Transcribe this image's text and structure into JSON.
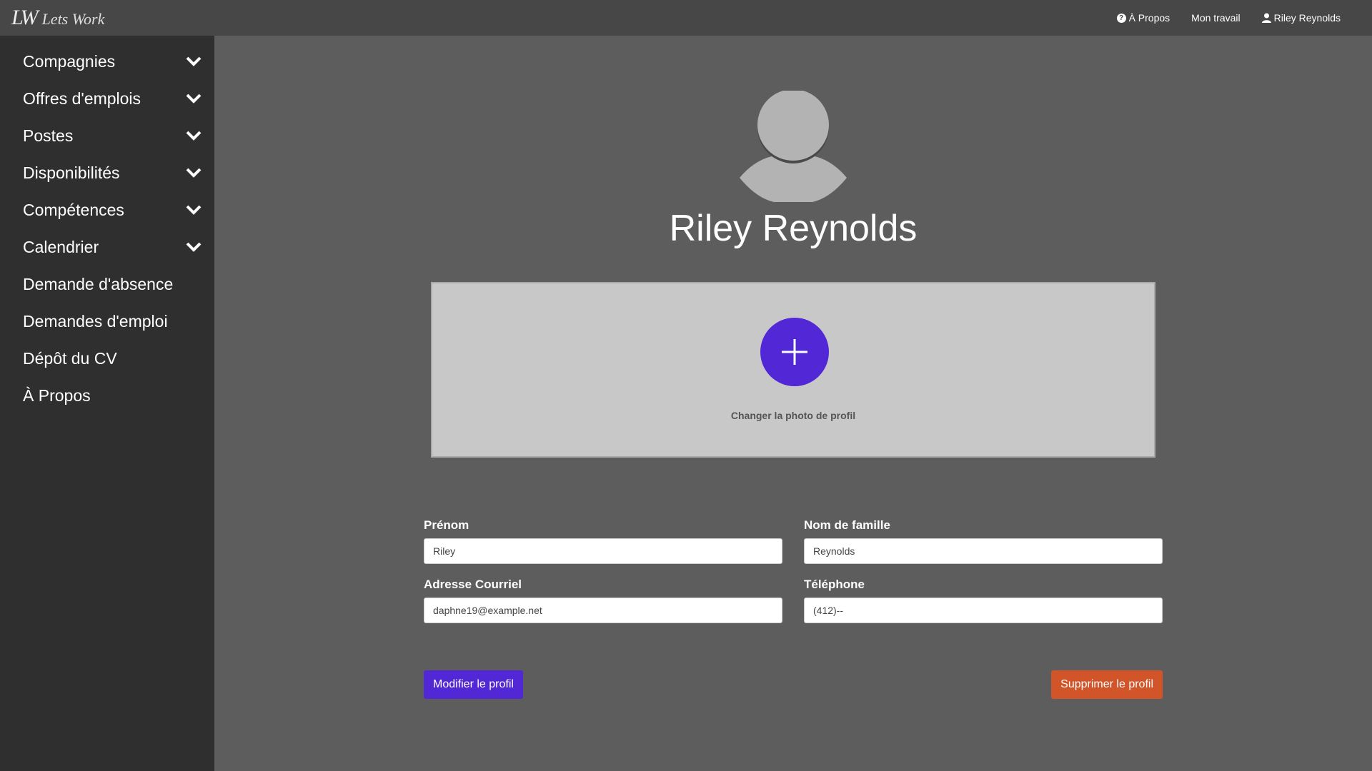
{
  "topbar": {
    "logo_mark": "LW",
    "brand_name": "Lets Work",
    "nav": {
      "about": "À Propos",
      "my_work": "Mon travail",
      "user": "Riley Reynolds"
    }
  },
  "sidebar": {
    "items": [
      {
        "label": "Compagnies",
        "has_submenu": true
      },
      {
        "label": "Offres d'emplois",
        "has_submenu": true
      },
      {
        "label": "Postes",
        "has_submenu": true
      },
      {
        "label": "Disponibilités",
        "has_submenu": true
      },
      {
        "label": "Compétences",
        "has_submenu": true
      },
      {
        "label": "Calendrier",
        "has_submenu": true
      },
      {
        "label": "Demande d'absence",
        "has_submenu": false
      },
      {
        "label": "Demandes d'emploi",
        "has_submenu": false
      },
      {
        "label": "Dépôt du CV",
        "has_submenu": false
      },
      {
        "label": "À Propos",
        "has_submenu": false
      }
    ]
  },
  "profile": {
    "name": "Riley Reynolds",
    "change_photo_label": "Changer la photo de profil"
  },
  "form": {
    "first_name": {
      "label": "Prénom",
      "value": "Riley"
    },
    "last_name": {
      "label": "Nom de famille",
      "value": "Reynolds"
    },
    "email": {
      "label": "Adresse Courriel",
      "value": "daphne19@example.net"
    },
    "phone": {
      "label": "Téléphone",
      "value": "(412)--"
    },
    "edit_button": "Modifier le profil",
    "delete_button": "Supprimer le profil"
  },
  "colors": {
    "accent": "#5227d6",
    "danger": "#d25429",
    "topbar": "#474747",
    "sidebar": "#2f2f2f",
    "background": "#5d5d5d"
  }
}
